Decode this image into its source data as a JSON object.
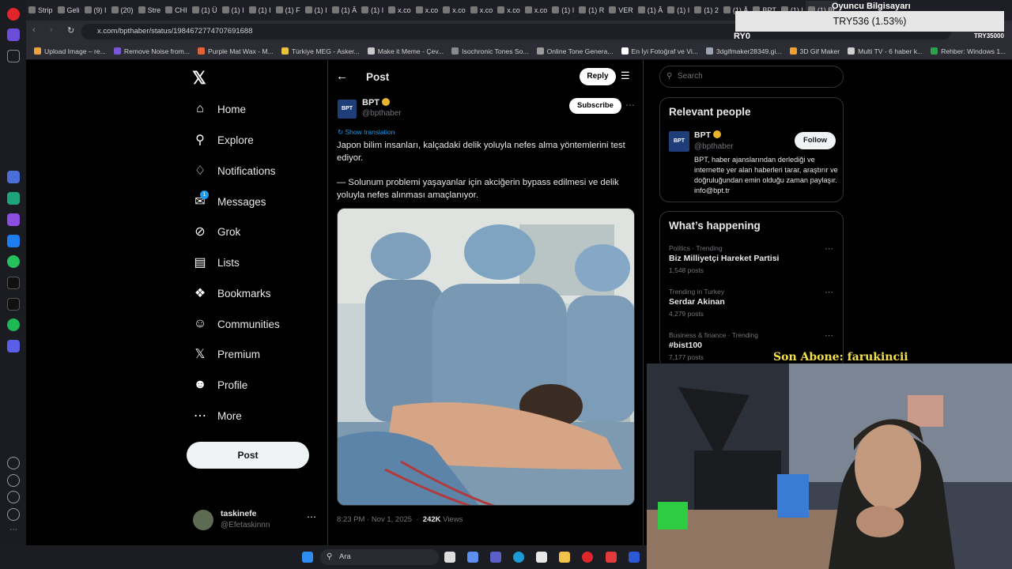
{
  "browser": {
    "tabs": [
      "Strip",
      "Geli",
      "(9) I",
      "(20)",
      "Stre",
      "CHI",
      "(1) Ü",
      "(1) I",
      "(1) I",
      "(1) F",
      "(1) I",
      "(1) Â",
      "(1) I",
      "x.co",
      "x.co",
      "x.co",
      "x.co",
      "x.co",
      "x.co",
      "(1) I",
      "(1) R",
      "VER",
      "(1) Â",
      "(1) I",
      "(1) 2",
      "(1) Å",
      "BPT",
      "(1) I",
      "(1) Bt"
    ],
    "url": "x.com/bpthaber/status/1984672774707691688",
    "bookmarks": [
      {
        "label": "Upload Image – re...",
        "color": "#e8a33c"
      },
      {
        "label": "Remove Noise from...",
        "color": "#7a55d6"
      },
      {
        "label": "Purple Mat Wax - M...",
        "color": "#e0643a"
      },
      {
        "label": "Türkiye MEG - Asker...",
        "color": "#e8c23c"
      },
      {
        "label": "Make it Meme - Çev...",
        "color": "#c7c7c7"
      },
      {
        "label": "Isochronic Tones So...",
        "color": "#8a8a8a"
      },
      {
        "label": "Online Tone Genera...",
        "color": "#9b9b9b"
      },
      {
        "label": "En İyi Fotoğraf ve Vi...",
        "color": "#ffffff"
      },
      {
        "label": "3dgifmaker28349.gi...",
        "color": "#9aa4b2"
      },
      {
        "label": "3D Gif Maker",
        "color": "#f0a030"
      },
      {
        "label": "Multi TV - 6 haber k...",
        "color": "#cfcfcf"
      },
      {
        "label": "Rehber: Windows 1...",
        "color": "#2aa34a"
      }
    ]
  },
  "nav": {
    "home": "Home",
    "explore": "Explore",
    "notifications": "Notifications",
    "messages": "Messages",
    "messages_badge": "1",
    "grok": "Grok",
    "lists": "Lists",
    "bookmarks": "Bookmarks",
    "communities": "Communities",
    "premium": "Premium",
    "profile": "Profile",
    "more": "More",
    "post_button": "Post",
    "account_name": "taskinefe",
    "account_handle": "@Efetaskinnn"
  },
  "post": {
    "header_title": "Post",
    "reply_label": "Reply",
    "author_avatar_text": "BPT",
    "author_name": "BPT",
    "author_handle": "@bpthaber",
    "subscribe_label": "Subscribe",
    "show_translation": "Show translation",
    "text_1": "Japon bilim insanları, kalçadaki delik yoluyla nefes alma yöntemlerini test ediyor.",
    "text_2": "— Solunum problemi yaşayanlar için akciğerin bypass edilmesi ve delik yoluyla nefes alınması amaçlanıyor.",
    "timestamp": "8:23 PM · Nov 1, 2025",
    "views_count": "242K",
    "views_label": "Views"
  },
  "sidebar": {
    "search_placeholder": "Search",
    "relevant_title": "Relevant people",
    "person_name": "BPT",
    "person_handle": "@bpthaber",
    "follow_label": "Follow",
    "person_bio": "BPT, haber ajanslarından derlediği ve internette yer alan haberleri tarar, araştırır ve doğruluğundan emin olduğu zaman paylaşır. info@bpt.tr",
    "happening_title": "What’s happening",
    "trends": [
      {
        "category": "Politics · Trending",
        "name": "Biz Milliyetçi Hareket Partisi",
        "count": "1,548 posts"
      },
      {
        "category": "Trending in Turkey",
        "name": "Serdar Akinan",
        "count": "4,279 posts"
      },
      {
        "category": "Business & finance · Trending",
        "name": "#bist100",
        "count": "7,177 posts"
      }
    ]
  },
  "overlay": {
    "oyuncu": "Oyuncu Bilgisayarı",
    "try_rate": "TRY536 (1.53%)",
    "try_left": "RY0",
    "try_right": "TRY35000",
    "son_abone": "Son Abone: farukincii"
  },
  "taskbar": {
    "search_label": "Ara"
  },
  "colors": {
    "accent_blue": "#1d9bf0",
    "verified_gold": "#e5b52e",
    "overlay_yellow": "#f4e04d"
  }
}
